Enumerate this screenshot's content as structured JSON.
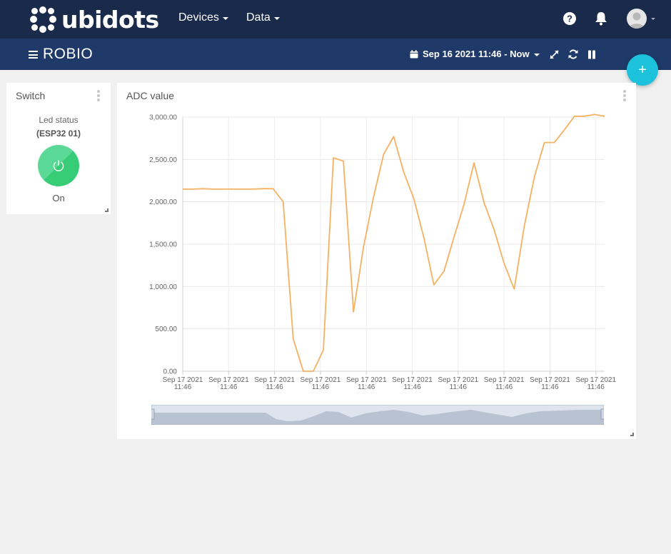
{
  "app": {
    "brand": "ubidots",
    "nav": [
      {
        "label": "Devices"
      },
      {
        "label": "Data"
      }
    ],
    "icons": [
      "help-icon",
      "bell-icon",
      "avatar"
    ]
  },
  "dashboard": {
    "title": "ROBIO",
    "date_range": "Sep 16 2021 11:46 - Now",
    "fab_label": "+"
  },
  "switch_widget": {
    "title": "Switch",
    "label": "Led status",
    "device": "(ESP32 01)",
    "state": "On"
  },
  "chart_widget": {
    "title": "ADC value"
  },
  "colors": {
    "topbar": "#1a2a4a",
    "subbar": "#1f3a68",
    "accent": "#1cc1dc",
    "switch_on": "#37cc76",
    "series": "#f5b162"
  },
  "chart_data": {
    "type": "line",
    "title": "ADC value",
    "xlabel": "",
    "ylabel": "",
    "ylim": [
      0,
      3000
    ],
    "grid": true,
    "y_ticks": [
      "0.00",
      "500.00",
      "1,000.00",
      "1,500.00",
      "2,000.00",
      "2,500.00",
      "3,000.00"
    ],
    "x_ticks": [
      {
        "date": "Sep 17 2021",
        "time": "11:46"
      },
      {
        "date": "Sep 17 2021",
        "time": "11:46"
      },
      {
        "date": "Sep 17 2021",
        "time": "11:46"
      },
      {
        "date": "Sep 17 2021",
        "time": "11:46"
      },
      {
        "date": "Sep 17 2021",
        "time": "11:46"
      },
      {
        "date": "Sep 17 2021",
        "time": "11:46"
      },
      {
        "date": "Sep 17 2021",
        "time": "11:46"
      },
      {
        "date": "Sep 17 2021",
        "time": "11:46"
      },
      {
        "date": "Sep 17 2021",
        "time": "11:46"
      },
      {
        "date": "Sep 17 2021",
        "time": "11:46"
      }
    ],
    "series": [
      {
        "values": [
          2150,
          2150,
          2155,
          2150,
          2150,
          2150,
          2150,
          2150,
          2155,
          2155,
          2000,
          380,
          0,
          0,
          250,
          2520,
          2480,
          700,
          1470,
          2060,
          2560,
          2770,
          2350,
          2040,
          1580,
          1020,
          1180,
          1580,
          1970,
          2460,
          1990,
          1670,
          1270,
          970,
          1710,
          2290,
          2700,
          2700,
          2850,
          3010,
          3010,
          3030,
          3010
        ]
      }
    ]
  }
}
